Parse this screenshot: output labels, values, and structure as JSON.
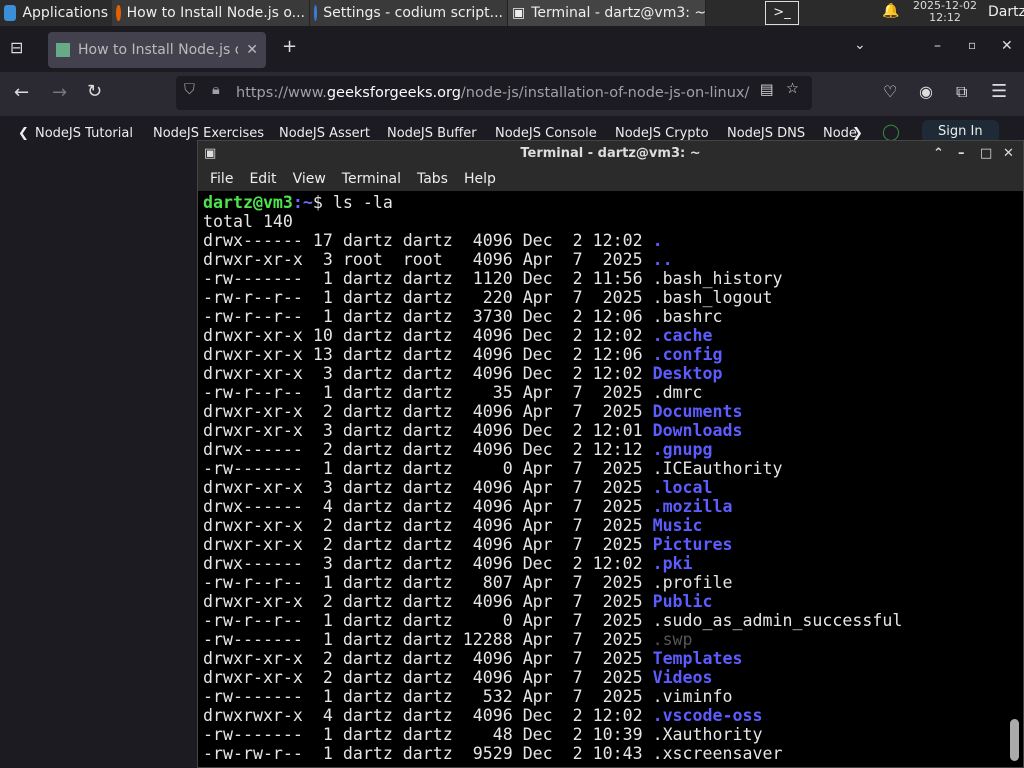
{
  "taskbar": {
    "apps_label": "Applications",
    "windows": [
      "How to Install Node.js o...",
      "Settings - codium script...",
      "Terminal - dartz@vm3: ~"
    ],
    "date": "2025-12-02",
    "time": "12:12",
    "user": "Dartz"
  },
  "browser": {
    "tab_title": "How to Install Node.js or",
    "url_prefix": "https://www.",
    "url_domain": "geeksforgeeks.org",
    "url_path": "/node-js/installation-of-node-js-on-linux/",
    "bookmarks": [
      "NodeJS Tutorial",
      "NodeJS Exercises",
      "NodeJS Assert",
      "NodeJS Buffer",
      "NodeJS Console",
      "NodeJS Crypto",
      "NodeJS DNS",
      "Node"
    ],
    "sign_in": "Sign In"
  },
  "terminal": {
    "title": "Terminal - dartz@vm3: ~",
    "menu": [
      "File",
      "Edit",
      "View",
      "Terminal",
      "Tabs",
      "Help"
    ],
    "prompt_user": "dartz@vm3",
    "prompt_path": ":~",
    "prompt_sym": "$ ",
    "command": "ls -la",
    "total": "total 140",
    "rows": [
      [
        "drwx------ 17 dartz dartz  4096 Dec  2 12:02 ",
        ".",
        "dir"
      ],
      [
        "drwxr-xr-x  3 root  root   4096 Apr  7  2025 ",
        "..",
        "dir"
      ],
      [
        "-rw-------  1 dartz dartz  1120 Dec  2 11:56 ",
        ".bash_history",
        "file"
      ],
      [
        "-rw-r--r--  1 dartz dartz   220 Apr  7  2025 ",
        ".bash_logout",
        "file"
      ],
      [
        "-rw-r--r--  1 dartz dartz  3730 Dec  2 12:06 ",
        ".bashrc",
        "file"
      ],
      [
        "drwxr-xr-x 10 dartz dartz  4096 Dec  2 12:02 ",
        ".cache",
        "dir"
      ],
      [
        "drwxr-xr-x 13 dartz dartz  4096 Dec  2 12:06 ",
        ".config",
        "dir"
      ],
      [
        "drwxr-xr-x  3 dartz dartz  4096 Dec  2 12:02 ",
        "Desktop",
        "dir"
      ],
      [
        "-rw-r--r--  1 dartz dartz    35 Apr  7  2025 ",
        ".dmrc",
        "file"
      ],
      [
        "drwxr-xr-x  2 dartz dartz  4096 Apr  7  2025 ",
        "Documents",
        "dir"
      ],
      [
        "drwxr-xr-x  3 dartz dartz  4096 Dec  2 12:01 ",
        "Downloads",
        "dir"
      ],
      [
        "drwx------  2 dartz dartz  4096 Dec  2 12:12 ",
        ".gnupg",
        "dir"
      ],
      [
        "-rw-------  1 dartz dartz     0 Apr  7  2025 ",
        ".ICEauthority",
        "file"
      ],
      [
        "drwxr-xr-x  3 dartz dartz  4096 Apr  7  2025 ",
        ".local",
        "dir"
      ],
      [
        "drwx------  4 dartz dartz  4096 Apr  7  2025 ",
        ".mozilla",
        "dir"
      ],
      [
        "drwxr-xr-x  2 dartz dartz  4096 Apr  7  2025 ",
        "Music",
        "dir"
      ],
      [
        "drwxr-xr-x  2 dartz dartz  4096 Apr  7  2025 ",
        "Pictures",
        "dir"
      ],
      [
        "drwx------  3 dartz dartz  4096 Dec  2 12:02 ",
        ".pki",
        "dir"
      ],
      [
        "-rw-r--r--  1 dartz dartz   807 Apr  7  2025 ",
        ".profile",
        "file"
      ],
      [
        "drwxr-xr-x  2 dartz dartz  4096 Apr  7  2025 ",
        "Public",
        "dir"
      ],
      [
        "-rw-r--r--  1 dartz dartz     0 Apr  7  2025 ",
        ".sudo_as_admin_successful",
        "file"
      ],
      [
        "-rw-------  1 dartz dartz 12288 Apr  7  2025 ",
        ".swp",
        "hid"
      ],
      [
        "drwxr-xr-x  2 dartz dartz  4096 Apr  7  2025 ",
        "Templates",
        "dir"
      ],
      [
        "drwxr-xr-x  2 dartz dartz  4096 Apr  7  2025 ",
        "Videos",
        "dir"
      ],
      [
        "-rw-------  1 dartz dartz   532 Apr  7  2025 ",
        ".viminfo",
        "file"
      ],
      [
        "drwxrwxr-x  4 dartz dartz  4096 Dec  2 12:02 ",
        ".vscode-oss",
        "dir"
      ],
      [
        "-rw-------  1 dartz dartz    48 Dec  2 10:39 ",
        ".Xauthority",
        "file"
      ],
      [
        "-rw-rw-r--  1 dartz dartz  9529 Dec  2 10:43 ",
        ".xscreensaver",
        "file"
      ]
    ]
  },
  "colors": {
    "dir": "#5c5cff",
    "prompt_user": "#4ee44e",
    "hidden": "#555555"
  }
}
